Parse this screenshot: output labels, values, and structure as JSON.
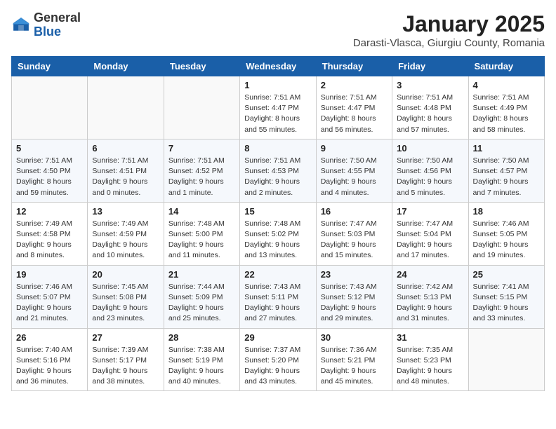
{
  "header": {
    "logo_general": "General",
    "logo_blue": "Blue",
    "month_title": "January 2025",
    "location": "Darasti-Vlasca, Giurgiu County, Romania"
  },
  "weekdays": [
    "Sunday",
    "Monday",
    "Tuesday",
    "Wednesday",
    "Thursday",
    "Friday",
    "Saturday"
  ],
  "weeks": [
    [
      {
        "day": "",
        "info": ""
      },
      {
        "day": "",
        "info": ""
      },
      {
        "day": "",
        "info": ""
      },
      {
        "day": "1",
        "info": "Sunrise: 7:51 AM\nSunset: 4:47 PM\nDaylight: 8 hours\nand 55 minutes."
      },
      {
        "day": "2",
        "info": "Sunrise: 7:51 AM\nSunset: 4:47 PM\nDaylight: 8 hours\nand 56 minutes."
      },
      {
        "day": "3",
        "info": "Sunrise: 7:51 AM\nSunset: 4:48 PM\nDaylight: 8 hours\nand 57 minutes."
      },
      {
        "day": "4",
        "info": "Sunrise: 7:51 AM\nSunset: 4:49 PM\nDaylight: 8 hours\nand 58 minutes."
      }
    ],
    [
      {
        "day": "5",
        "info": "Sunrise: 7:51 AM\nSunset: 4:50 PM\nDaylight: 8 hours\nand 59 minutes."
      },
      {
        "day": "6",
        "info": "Sunrise: 7:51 AM\nSunset: 4:51 PM\nDaylight: 9 hours\nand 0 minutes."
      },
      {
        "day": "7",
        "info": "Sunrise: 7:51 AM\nSunset: 4:52 PM\nDaylight: 9 hours\nand 1 minute."
      },
      {
        "day": "8",
        "info": "Sunrise: 7:51 AM\nSunset: 4:53 PM\nDaylight: 9 hours\nand 2 minutes."
      },
      {
        "day": "9",
        "info": "Sunrise: 7:50 AM\nSunset: 4:55 PM\nDaylight: 9 hours\nand 4 minutes."
      },
      {
        "day": "10",
        "info": "Sunrise: 7:50 AM\nSunset: 4:56 PM\nDaylight: 9 hours\nand 5 minutes."
      },
      {
        "day": "11",
        "info": "Sunrise: 7:50 AM\nSunset: 4:57 PM\nDaylight: 9 hours\nand 7 minutes."
      }
    ],
    [
      {
        "day": "12",
        "info": "Sunrise: 7:49 AM\nSunset: 4:58 PM\nDaylight: 9 hours\nand 8 minutes."
      },
      {
        "day": "13",
        "info": "Sunrise: 7:49 AM\nSunset: 4:59 PM\nDaylight: 9 hours\nand 10 minutes."
      },
      {
        "day": "14",
        "info": "Sunrise: 7:48 AM\nSunset: 5:00 PM\nDaylight: 9 hours\nand 11 minutes."
      },
      {
        "day": "15",
        "info": "Sunrise: 7:48 AM\nSunset: 5:02 PM\nDaylight: 9 hours\nand 13 minutes."
      },
      {
        "day": "16",
        "info": "Sunrise: 7:47 AM\nSunset: 5:03 PM\nDaylight: 9 hours\nand 15 minutes."
      },
      {
        "day": "17",
        "info": "Sunrise: 7:47 AM\nSunset: 5:04 PM\nDaylight: 9 hours\nand 17 minutes."
      },
      {
        "day": "18",
        "info": "Sunrise: 7:46 AM\nSunset: 5:05 PM\nDaylight: 9 hours\nand 19 minutes."
      }
    ],
    [
      {
        "day": "19",
        "info": "Sunrise: 7:46 AM\nSunset: 5:07 PM\nDaylight: 9 hours\nand 21 minutes."
      },
      {
        "day": "20",
        "info": "Sunrise: 7:45 AM\nSunset: 5:08 PM\nDaylight: 9 hours\nand 23 minutes."
      },
      {
        "day": "21",
        "info": "Sunrise: 7:44 AM\nSunset: 5:09 PM\nDaylight: 9 hours\nand 25 minutes."
      },
      {
        "day": "22",
        "info": "Sunrise: 7:43 AM\nSunset: 5:11 PM\nDaylight: 9 hours\nand 27 minutes."
      },
      {
        "day": "23",
        "info": "Sunrise: 7:43 AM\nSunset: 5:12 PM\nDaylight: 9 hours\nand 29 minutes."
      },
      {
        "day": "24",
        "info": "Sunrise: 7:42 AM\nSunset: 5:13 PM\nDaylight: 9 hours\nand 31 minutes."
      },
      {
        "day": "25",
        "info": "Sunrise: 7:41 AM\nSunset: 5:15 PM\nDaylight: 9 hours\nand 33 minutes."
      }
    ],
    [
      {
        "day": "26",
        "info": "Sunrise: 7:40 AM\nSunset: 5:16 PM\nDaylight: 9 hours\nand 36 minutes."
      },
      {
        "day": "27",
        "info": "Sunrise: 7:39 AM\nSunset: 5:17 PM\nDaylight: 9 hours\nand 38 minutes."
      },
      {
        "day": "28",
        "info": "Sunrise: 7:38 AM\nSunset: 5:19 PM\nDaylight: 9 hours\nand 40 minutes."
      },
      {
        "day": "29",
        "info": "Sunrise: 7:37 AM\nSunset: 5:20 PM\nDaylight: 9 hours\nand 43 minutes."
      },
      {
        "day": "30",
        "info": "Sunrise: 7:36 AM\nSunset: 5:21 PM\nDaylight: 9 hours\nand 45 minutes."
      },
      {
        "day": "31",
        "info": "Sunrise: 7:35 AM\nSunset: 5:23 PM\nDaylight: 9 hours\nand 48 minutes."
      },
      {
        "day": "",
        "info": ""
      }
    ]
  ]
}
